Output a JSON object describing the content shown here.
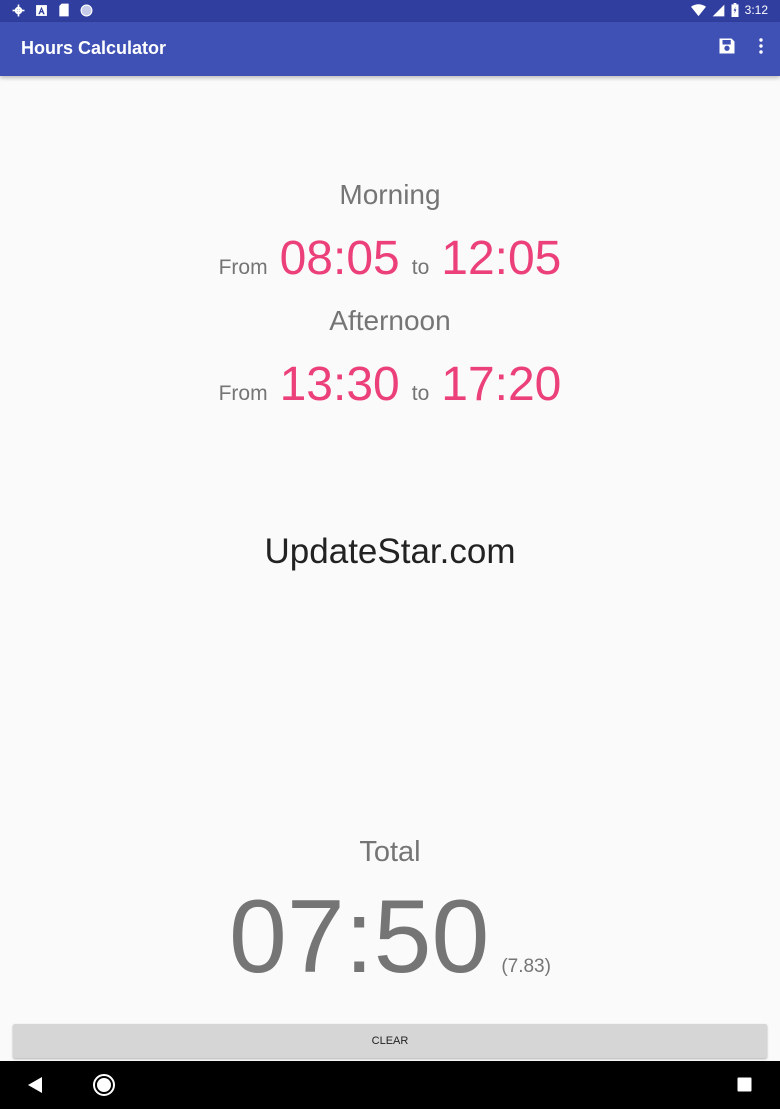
{
  "status_bar": {
    "time": "3:12",
    "icons": [
      "settings-icon",
      "font-icon",
      "sd-card-icon",
      "circle-icon",
      "wifi-icon",
      "signal-icon",
      "battery-icon"
    ]
  },
  "app_bar": {
    "title": "Hours Calculator",
    "actions": [
      "save-icon",
      "more-options-icon"
    ]
  },
  "morning": {
    "label": "Morning",
    "from_label": "From",
    "from_time": "08:05",
    "to_label": "to",
    "to_time": "12:05"
  },
  "afternoon": {
    "label": "Afternoon",
    "from_label": "From",
    "from_time": "13:30",
    "to_label": "to",
    "to_time": "17:20"
  },
  "watermark": "UpdateStar.com",
  "total": {
    "label": "Total",
    "value": "07:50",
    "decimal": "(7.83)"
  },
  "clear_button": "CLEAR",
  "nav_bar": [
    "back-icon",
    "home-icon",
    "recents-icon"
  ],
  "colors": {
    "primary": "#3f51b5",
    "primary_dark": "#303f9f",
    "accent": "#ec407a"
  }
}
